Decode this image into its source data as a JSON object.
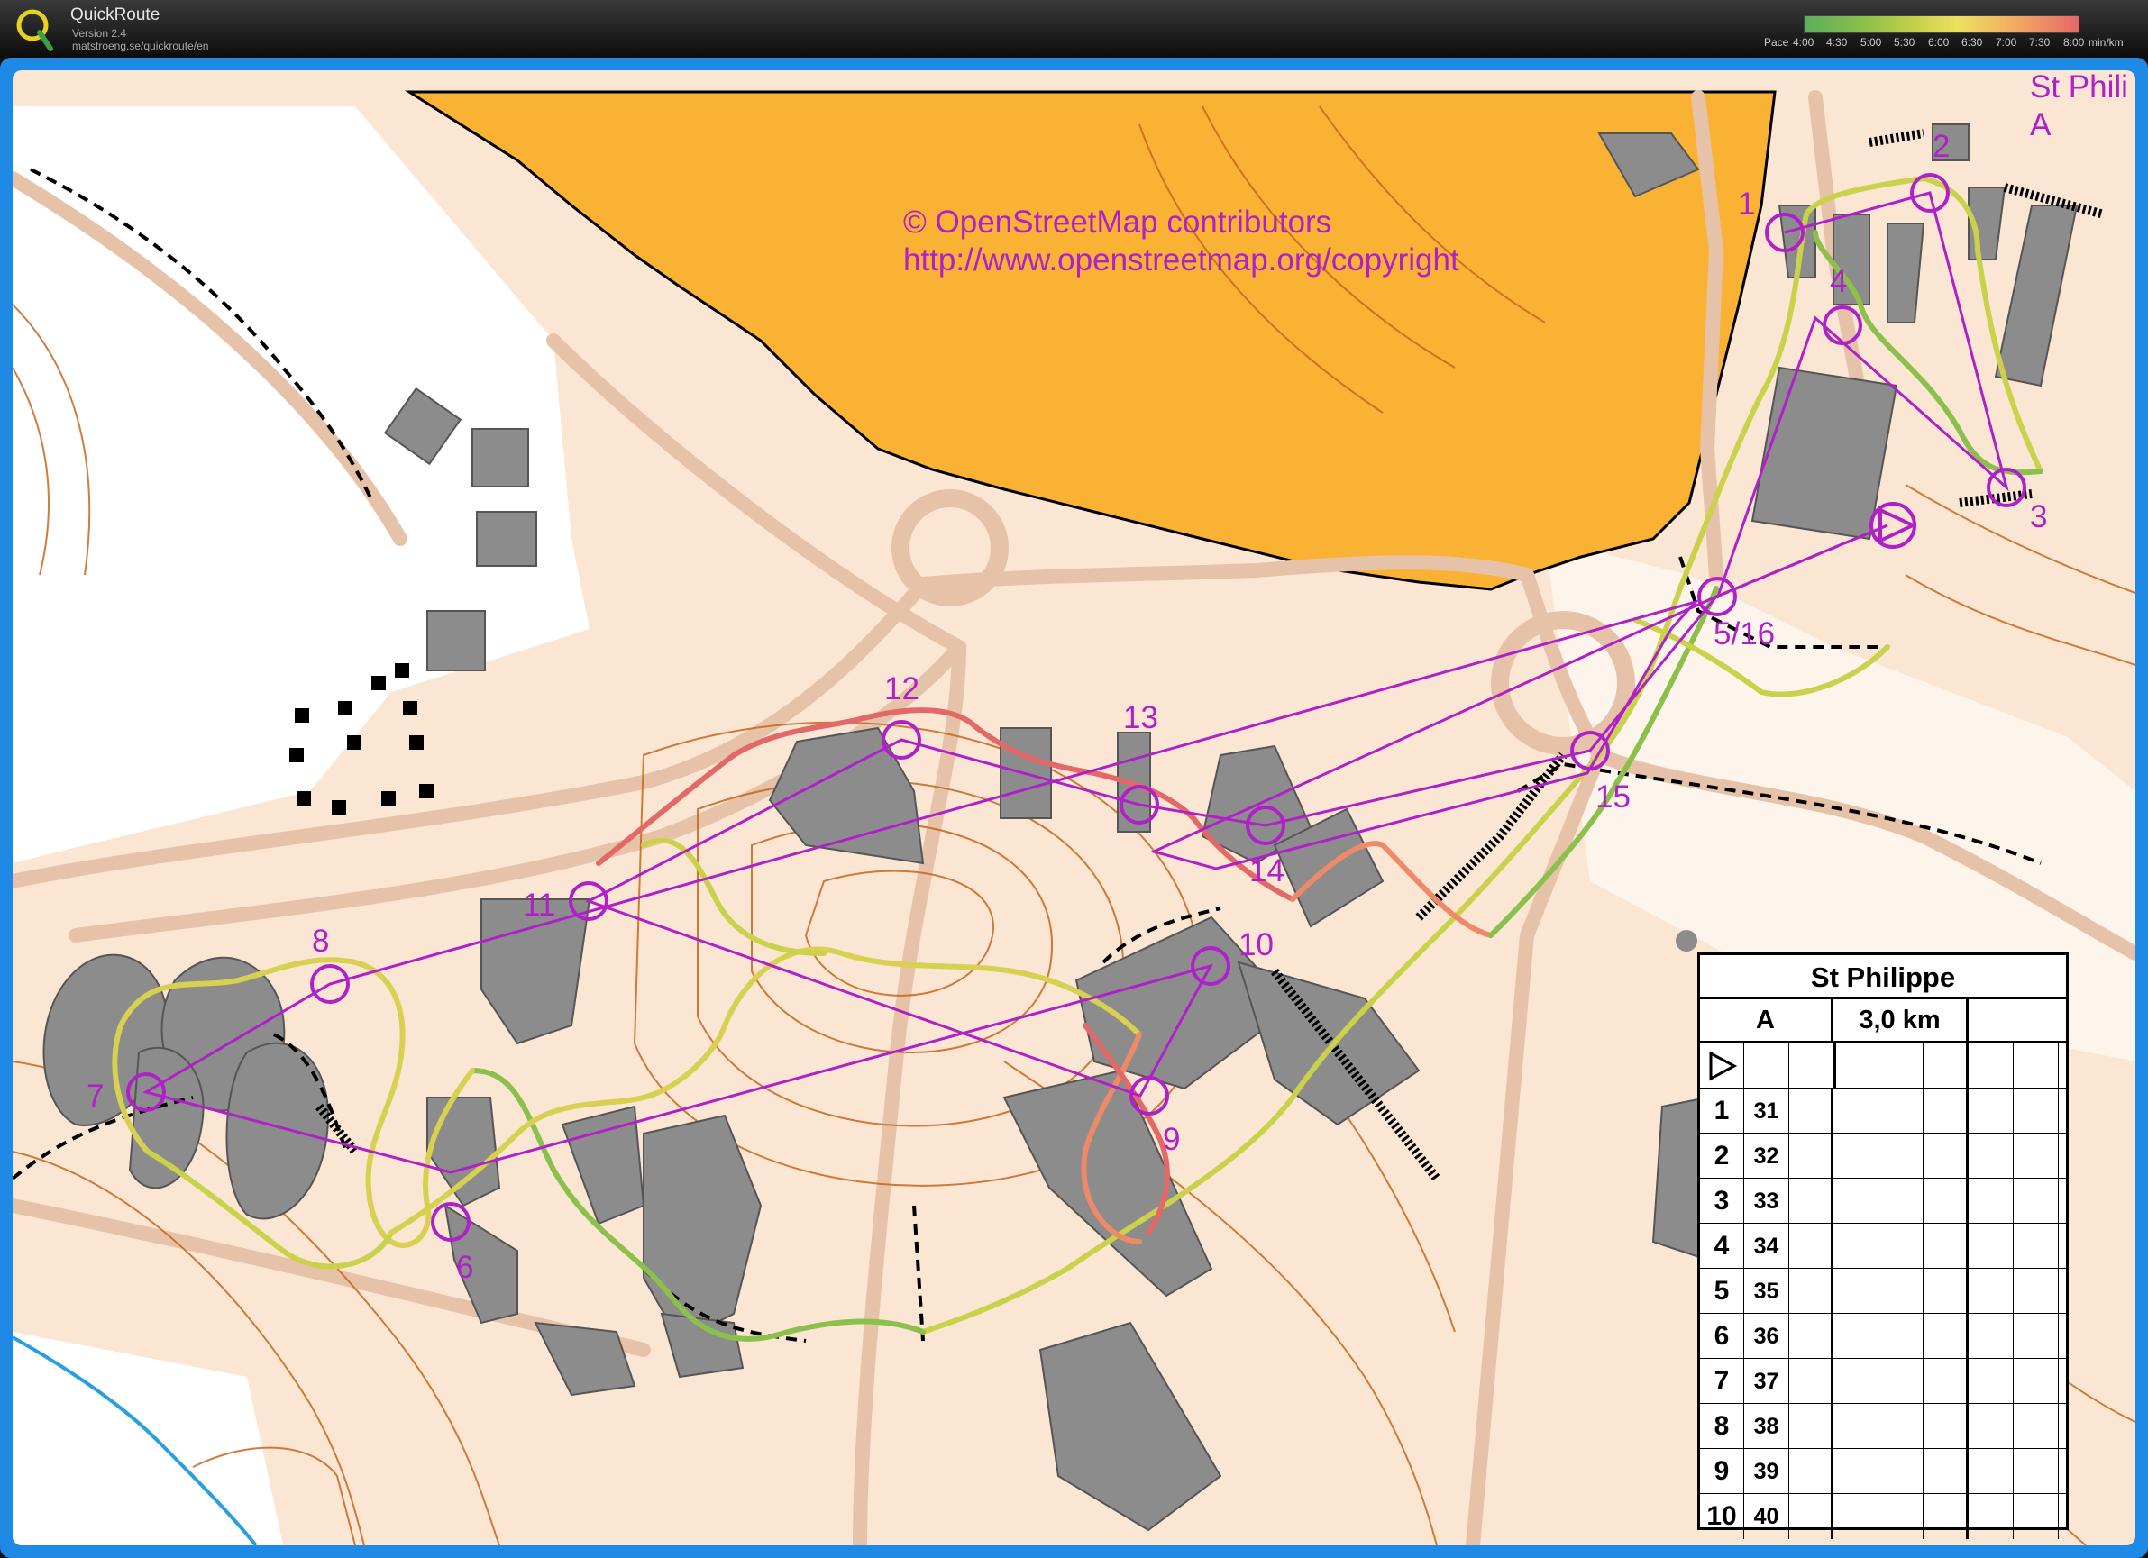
{
  "app": {
    "name": "QuickRoute",
    "version": "Version 2.4",
    "url": "matstroeng.se/quickroute/en"
  },
  "pace_scale": {
    "label": "Pace",
    "ticks": [
      "4:00",
      "4:30",
      "5:00",
      "5:30",
      "6:00",
      "6:30",
      "7:00",
      "7:30",
      "8:00"
    ],
    "unit": "min/km"
  },
  "map": {
    "copyright_line1": "© OpenStreetMap contributors",
    "copyright_line2": "http://www.openstreetmap.org/copyright",
    "corner_title": "St Phili",
    "corner_class": "A",
    "control_labels": [
      "1",
      "2",
      "3",
      "4",
      "5/16",
      "6",
      "7",
      "8",
      "9",
      "10",
      "11",
      "12",
      "13",
      "14",
      "15"
    ],
    "colors": {
      "background": "#fbe6d3",
      "open_land": "#f9b233",
      "building": "#8c8c8c",
      "course": "#b020c8",
      "contour": "#c8661e",
      "water": "#2a9fe0"
    }
  },
  "legend": {
    "title": "St Philippe",
    "class": "A",
    "length": "3,0 km",
    "rows": [
      {
        "num": "1",
        "code": "31"
      },
      {
        "num": "2",
        "code": "32"
      },
      {
        "num": "3",
        "code": "33"
      },
      {
        "num": "4",
        "code": "34"
      },
      {
        "num": "5",
        "code": "35"
      },
      {
        "num": "6",
        "code": "36"
      },
      {
        "num": "7",
        "code": "37"
      },
      {
        "num": "8",
        "code": "38"
      },
      {
        "num": "9",
        "code": "39"
      },
      {
        "num": "10",
        "code": "40"
      }
    ]
  }
}
